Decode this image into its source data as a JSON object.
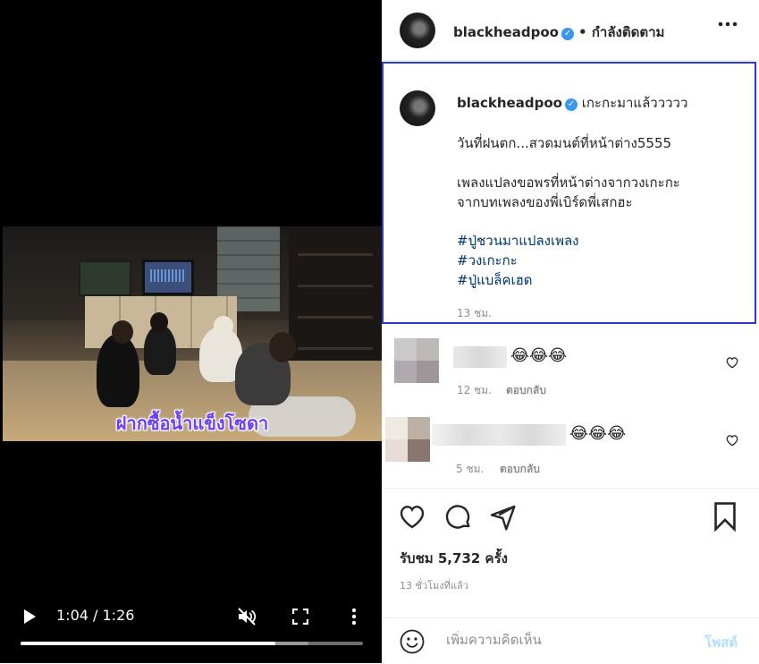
{
  "video": {
    "subtitle": "ฝากซื้อน้ำแข็งโซดา",
    "time": "1:04 / 1:26",
    "progress_fraction": 0.745,
    "buffered_fraction": 0.84
  },
  "post": {
    "username": "blackheadpoo",
    "follow_status": "• กำลังติดตาม",
    "caption": {
      "first_line": "เกะกะมาแล้ววววว",
      "line2": "วันที่ฝนตก...สวดมนต์ที่หน้าต่าง5555",
      "line3": "เพลงแปลงขอพรที่หน้าต่างจากวงเกะกะ",
      "line4": "จากบทเพลงของพี่เบิร์ดพี่เสกฮะ",
      "tags": [
        "#ปู่ชวนมาแปลงเพลง",
        "#วงเกะกะ",
        "#ปู่แบล็คเฮด"
      ],
      "time": "13 ชม."
    },
    "comments": [
      {
        "emojis": "😂😂😂",
        "time": "12 ชม.",
        "reply": "ตอบกลับ"
      },
      {
        "emojis": "😂😂😂",
        "time": "5 ชม.",
        "reply": "ตอบกลับ"
      }
    ],
    "likes": "รับชม 5,732 ครั้ง",
    "time_ago": "13 ชั่วโมงที่แล้ว",
    "composer": {
      "placeholder": "เพิ่มความคิดเห็น",
      "post_label": "โพสต์"
    }
  },
  "icons": {
    "verified": "verified-badge-icon",
    "more": "more-horizontal-icon",
    "like": "heart-icon",
    "comment": "comment-bubble-icon",
    "share": "paper-plane-icon",
    "save": "bookmark-icon",
    "emoji": "smiley-icon"
  },
  "colors": {
    "accent": "#3897f0",
    "hashtag": "#00376b",
    "highlight_border": "#2b3bcc",
    "post_button": "#b2dffc"
  }
}
